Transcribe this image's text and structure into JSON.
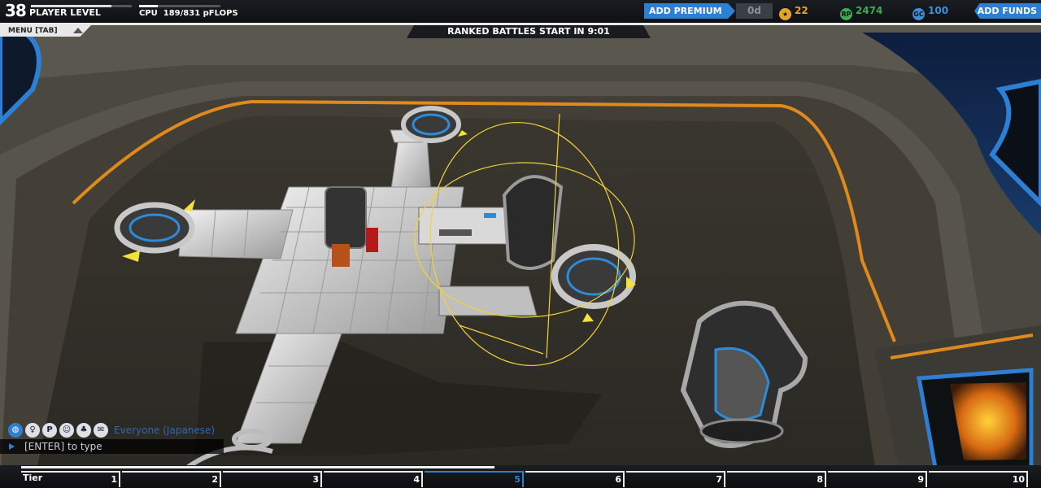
{
  "hud": {
    "player_level": "38",
    "player_level_label": "PLAYER LEVEL",
    "level_progress": 0.8,
    "cpu_label": "CPU",
    "cpu_value": "189/831 pFLOPS",
    "cpu_used": 189,
    "cpu_max": 831,
    "add_premium": "ADD PREMIUM",
    "premium_days": "0d",
    "robits_icon_color": "#f2b632",
    "robits": "22",
    "rp": "2474",
    "gc": "100",
    "add_funds": "ADD FUNDS",
    "menu": "MENU [TAB]",
    "ranked": "RANKED BATTLES START IN 9:01"
  },
  "colors": {
    "accent_blue": "#2d7fd4",
    "star_gold": "#e2a52b",
    "rp_green": "#3faa52",
    "gc_blue": "#3e8fd8",
    "orange_trim": "#e08a1c",
    "gizmo_yellow": "#f2d23a"
  },
  "chat": {
    "icons": [
      "globe-icon",
      "person-icon",
      "party-icon",
      "friends-icon",
      "clan-icon",
      "whisper-icon"
    ],
    "channel": "Everyone (Japanese)",
    "placeholder": "[ENTER] to type"
  },
  "tiers": {
    "label": "Tier",
    "items": [
      "1",
      "2",
      "3",
      "4",
      "5",
      "6",
      "7",
      "8",
      "9",
      "10"
    ],
    "current_index": 4,
    "progress": 0.4
  }
}
